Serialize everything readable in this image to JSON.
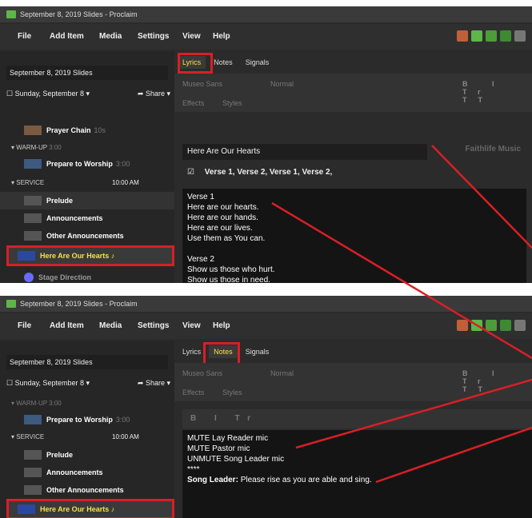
{
  "window_title": "September 8, 2019 Slides - Proclaim",
  "menu": [
    "File",
    "Add Item",
    "Media",
    "Settings",
    "View",
    "Help"
  ],
  "presentation_title": "September 8, 2019 Slides",
  "date_label": "Sunday, September 8",
  "share_label": "Share",
  "tabs": [
    "Lyrics",
    "Notes",
    "Signals"
  ],
  "toolbar": {
    "font": "Museo Sans",
    "weight": "Normal",
    "effects": "Effects",
    "styles": "Styles",
    "format_buttons": "B I Tr TT",
    "notes_format": "B I Tr"
  },
  "top_items": {
    "prayer_chain": {
      "label": "Prayer Chain",
      "dur": "10s"
    },
    "warmup": {
      "label": "WARM-UP",
      "time": "3:00"
    },
    "prepare": {
      "label": "Prepare to Worship",
      "dur": "3:00"
    },
    "service": {
      "label": "SERVICE",
      "time": "10:00 AM"
    },
    "prelude": {
      "label": "Prelude"
    },
    "announcements": {
      "label": "Announcements"
    },
    "other": {
      "label": "Other Announcements"
    },
    "hearts": {
      "label": "Here Are Our Hearts ♪"
    },
    "stage": {
      "label": "Stage Direction"
    }
  },
  "song_title": "Here Are Our Hearts",
  "faithlife": "Faithlife Music",
  "verse_order": "Verse 1, Verse 2, Verse 1, Verse 2,",
  "lyrics": [
    "Verse 1",
    "Here are our hearts.",
    "Here are our hands.",
    "Here are our lives.",
    "Use them as You can.",
    "",
    "Verse 2",
    "Show us those who hurt.",
    "Show us those in need."
  ],
  "notes": {
    "lines": [
      "MUTE Lay Reader mic",
      "MUTE Pastor mic",
      "UNMUTE Song Leader mic",
      "****"
    ],
    "leader_label": "Song Leader:",
    "leader_text": "Please rise as you are able and sing."
  }
}
